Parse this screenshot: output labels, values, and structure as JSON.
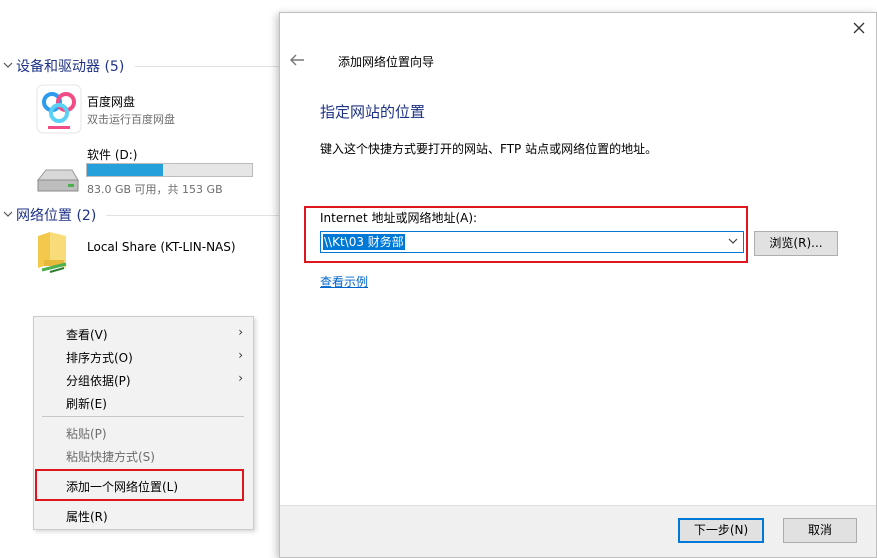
{
  "explorer": {
    "groups": [
      {
        "title": "设备和驱动器 (5)"
      },
      {
        "title": "网络位置 (2)"
      }
    ],
    "baidu": {
      "name": "百度网盘",
      "sub": "双击运行百度网盘",
      "icon": "baidu-netdisk-icon"
    },
    "drive": {
      "name": "软件 (D:)",
      "sub": "83.0 GB 可用，共 153 GB",
      "used_fraction": 0.46,
      "icon": "hard-drive-icon"
    },
    "share": {
      "name": "Local Share (KT-LIN-NAS)",
      "icon": "network-folder-icon"
    }
  },
  "context_menu": {
    "items": [
      {
        "label": "查看(V)",
        "submenu": true,
        "disabled": false
      },
      {
        "label": "排序方式(O)",
        "submenu": true,
        "disabled": false
      },
      {
        "label": "分组依据(P)",
        "submenu": true,
        "disabled": false
      },
      {
        "label": "刷新(E)",
        "submenu": false,
        "disabled": false
      },
      {
        "label": "粘贴(P)",
        "submenu": false,
        "disabled": true
      },
      {
        "label": "粘贴快捷方式(S)",
        "submenu": false,
        "disabled": true
      },
      {
        "label": "添加一个网络位置(L)",
        "submenu": false,
        "disabled": false,
        "highlighted": true
      },
      {
        "label": "属性(R)",
        "submenu": false,
        "disabled": false
      }
    ]
  },
  "wizard": {
    "title": "添加网络位置向导",
    "heading": "指定网站的位置",
    "description": "键入这个快捷方式要打开的网站、FTP 站点或网络位置的地址。",
    "address_label": "Internet 地址或网络地址(A):",
    "address_value": "\\\\Kt\\03 财务部",
    "browse_label": "浏览(R)...",
    "example_link": "查看示例",
    "next_label": "下一步(N)",
    "cancel_label": "取消"
  },
  "colors": {
    "accent": "#0078d7",
    "group_title": "#1e3287",
    "highlight_box": "#e0161f",
    "drive_bar": "#26a0da"
  }
}
